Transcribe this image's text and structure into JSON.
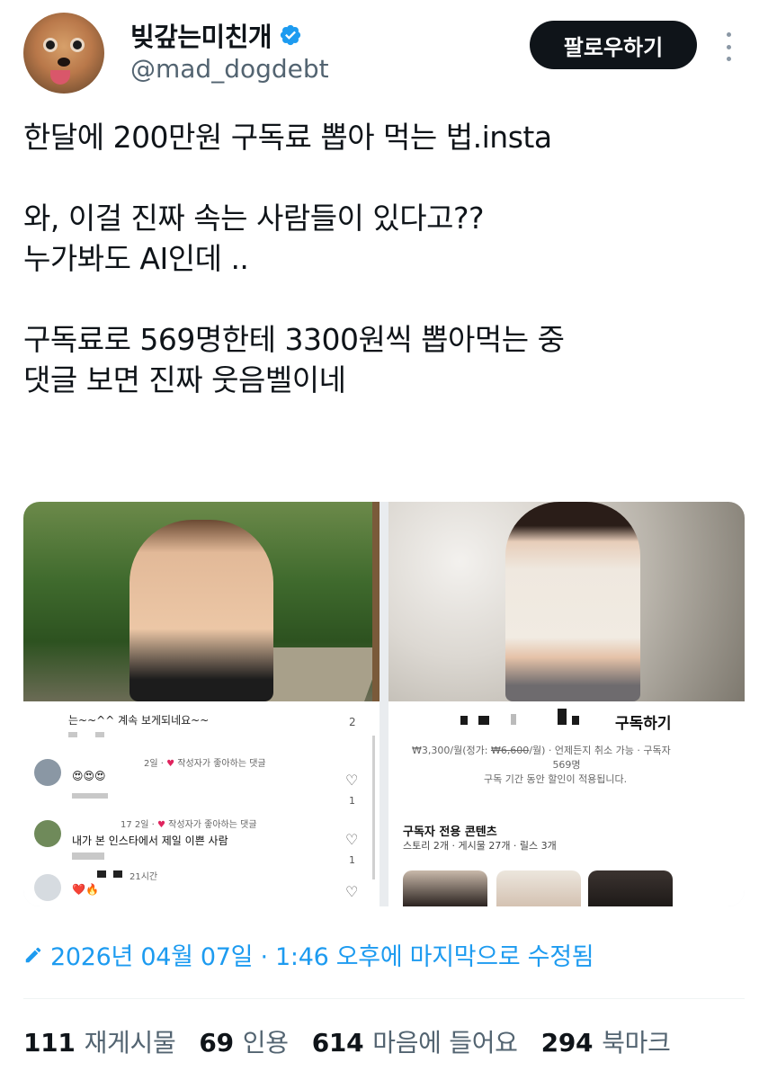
{
  "author": {
    "display_name": "빚갚는미친개",
    "handle": "@mad_dogdebt",
    "verified_icon": "verified-badge-icon",
    "verified_color": "#1d9bf0"
  },
  "follow_button": {
    "label": "팔로우하기"
  },
  "more_button": {
    "icon": "more-vertical-icon"
  },
  "tweet": {
    "lines": [
      "한달에 200만원 구독료 뽑아 먹는 법.insta",
      "",
      "와, 이걸 진짜 속는 사람들이 있다고??",
      "누가봐도 AI인데 ..",
      "",
      "구독료로 569명한테 3300원씩 뽑아먹는 중",
      "댓글 보면 진짜 웃음벨이네"
    ]
  },
  "media": {
    "left_panel": {
      "top_comment": "는~~^^ 계속 보게되네요~~",
      "top_count": "2",
      "comments": [
        {
          "meta_prefix": "2일 · ",
          "meta_heart": "♥",
          "meta_suffix": " 작성자가 좋아하는 댓글",
          "body": "😍😍😍",
          "like_count": "1"
        },
        {
          "meta_prefix": "17 2일 · ",
          "meta_heart": "♥",
          "meta_suffix": " 작성자가 좋아하는 댓글",
          "body": "내가 본 인스타에서 제일 이쁜 사람",
          "like_count": "1"
        },
        {
          "meta_prefix": "21시간",
          "meta_heart": "",
          "meta_suffix": "",
          "body": "❤️🔥",
          "like_count": ""
        }
      ]
    },
    "right_panel": {
      "subscribe_title": "구독하기",
      "price_prefix": "₩3,300/월(정가: ",
      "price_original": "₩6,600",
      "price_suffix": "/월) · 언제든지 취소 가능 · 구독자",
      "subscriber_count": "569명",
      "discount_note": "구독 기간 동안 할인이 적용됩니다.",
      "exclusive_title": "구독자 전용 콘텐츠",
      "exclusive_meta": "스토리 2개 · 게시물 27개 · 릴스 3개"
    }
  },
  "edit_info": {
    "icon": "pencil-icon",
    "text": "2026년 04월 07일 · 1:46 오후에 마지막으로 수정됨"
  },
  "stats": [
    {
      "value": "111",
      "label": "재게시물"
    },
    {
      "value": "69",
      "label": "인용"
    },
    {
      "value": "614",
      "label": "마음에 들어요"
    },
    {
      "value": "294",
      "label": "북마크"
    }
  ]
}
